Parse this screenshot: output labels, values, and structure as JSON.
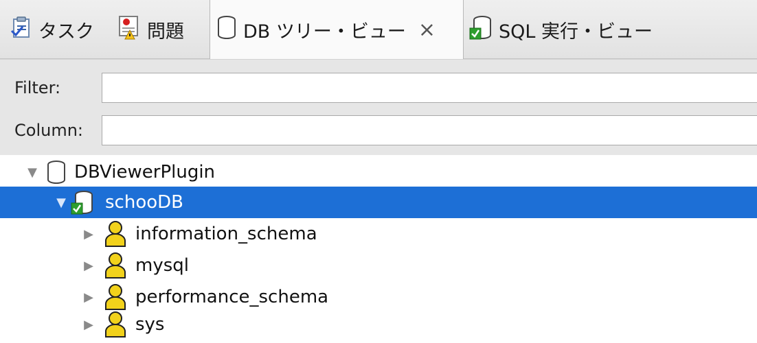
{
  "tabs": [
    {
      "label": "タスク",
      "icon": "task-list-icon",
      "active": false
    },
    {
      "label": "問題",
      "icon": "problems-icon",
      "active": false
    },
    {
      "label": "DB ツリー・ビュー",
      "icon": "database-icon",
      "active": true,
      "close_icon": "close-icon"
    },
    {
      "label": "SQL 実行・ビュー",
      "icon": "database-connected-icon",
      "active": false
    }
  ],
  "filter": {
    "filter_label": "Filter:",
    "filter_value": "",
    "column_label": "Column:",
    "column_value": ""
  },
  "tree": {
    "root": {
      "label": "DBViewerPlugin",
      "icon": "database-icon",
      "expanded": true
    },
    "connection": {
      "label": "schooDB",
      "icon": "database-connected-icon",
      "expanded": true,
      "selected": true
    },
    "schemas": [
      {
        "label": "information_schema",
        "icon": "schema-user-icon",
        "expanded": false
      },
      {
        "label": "mysql",
        "icon": "schema-user-icon",
        "expanded": false
      },
      {
        "label": "performance_schema",
        "icon": "schema-user-icon",
        "expanded": false
      },
      {
        "label": "sys",
        "icon": "schema-user-icon",
        "expanded": false
      }
    ]
  },
  "colors": {
    "selection": "#1d6fd6",
    "schema_icon": "#f2d21b",
    "check_green": "#2e9e2e"
  }
}
